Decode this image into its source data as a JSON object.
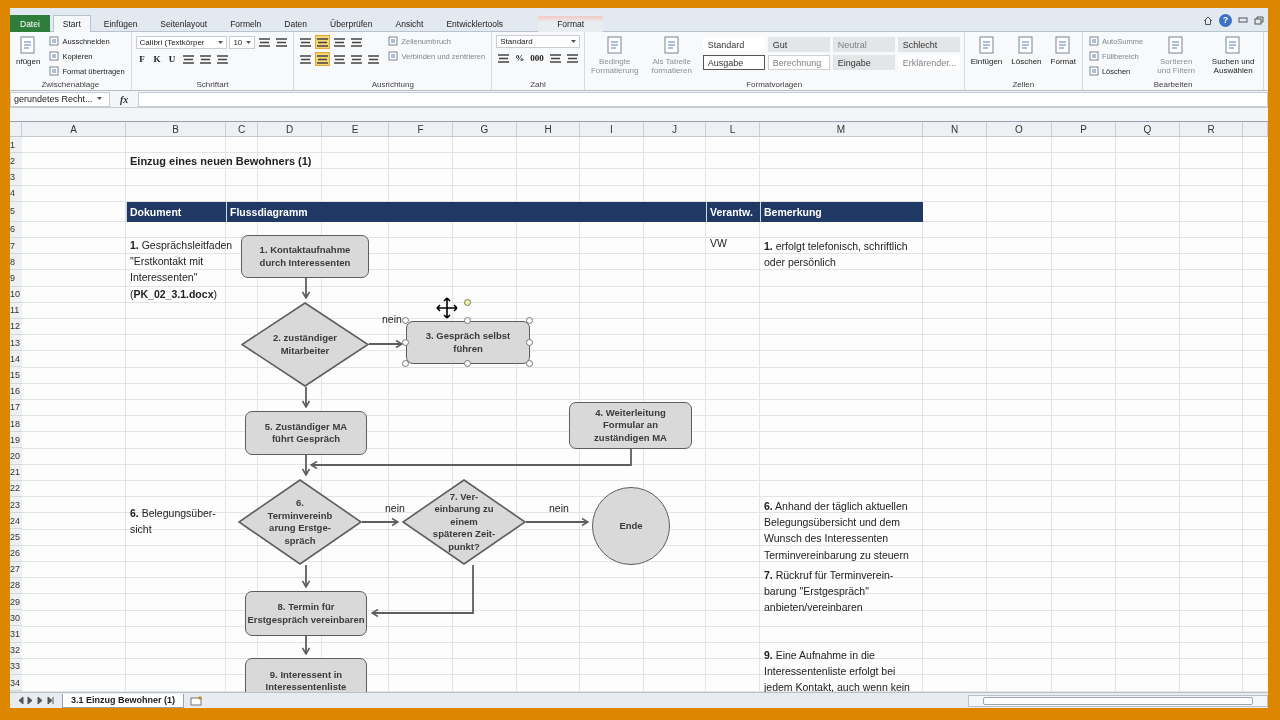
{
  "tabs": [
    {
      "label": "Datei",
      "kind": "file",
      "selected": false
    },
    {
      "label": "Start",
      "kind": "normal",
      "selected": true
    },
    {
      "label": "Einfügen",
      "kind": "normal",
      "selected": false
    },
    {
      "label": "Seitenlayout",
      "kind": "normal",
      "selected": false
    },
    {
      "label": "Formeln",
      "kind": "normal",
      "selected": false
    },
    {
      "label": "Daten",
      "kind": "normal",
      "selected": false
    },
    {
      "label": "Überprüfen",
      "kind": "normal",
      "selected": false
    },
    {
      "label": "Ansicht",
      "kind": "normal",
      "selected": false
    },
    {
      "label": "Entwicklertools",
      "kind": "normal",
      "selected": false
    },
    {
      "label": "Format",
      "kind": "contextual",
      "selected": false
    }
  ],
  "window_controls": {
    "help": "?"
  },
  "ribbon": {
    "groups": [
      {
        "label": "Zwischenablage",
        "columns": [
          [
            {
              "kind": "large",
              "label": "nfügen"
            }
          ],
          [
            {
              "kind": "small",
              "label": "Ausschneiden"
            },
            {
              "kind": "small",
              "label": "Kopieren"
            },
            {
              "kind": "small",
              "label": "Format übertragen"
            }
          ]
        ]
      },
      {
        "label": "Schriftart",
        "columns": [
          [
            {
              "kind": "row",
              "items": [
                {
                  "kind": "combo",
                  "value": "Calibri (Textkörper"
                },
                {
                  "kind": "combo",
                  "value": "10"
                },
                {
                  "kind": "icon"
                },
                {
                  "kind": "icon"
                }
              ]
            },
            {
              "kind": "row",
              "items": [
                {
                  "kind": "char",
                  "label": "F"
                },
                {
                  "kind": "char",
                  "label": "K"
                },
                {
                  "kind": "char",
                  "label": "U"
                },
                {
                  "kind": "icon"
                },
                {
                  "kind": "icon"
                },
                {
                  "kind": "icon"
                }
              ]
            }
          ]
        ]
      },
      {
        "label": "Ausrichtung",
        "columns": [
          [
            {
              "kind": "row",
              "items": [
                {
                  "kind": "icon",
                  "selected": false
                },
                {
                  "kind": "icon",
                  "selected": true
                },
                {
                  "kind": "icon",
                  "selected": false
                },
                {
                  "kind": "icon",
                  "selected": false
                }
              ]
            },
            {
              "kind": "row",
              "items": [
                {
                  "kind": "icon",
                  "selected": false
                },
                {
                  "kind": "icon",
                  "selected": true
                },
                {
                  "kind": "icon",
                  "selected": false
                },
                {
                  "kind": "icon",
                  "selected": false
                },
                {
                  "kind": "icon",
                  "selected": false
                }
              ]
            }
          ],
          [
            {
              "kind": "small",
              "label": "Zeilenumbruch",
              "disabled": true
            },
            {
              "kind": "small",
              "label": "Verbinden und zentrieren",
              "disabled": true
            }
          ]
        ]
      },
      {
        "label": "Zahl",
        "columns": [
          [
            {
              "kind": "combo",
              "value": "Standard"
            },
            {
              "kind": "row",
              "items": [
                {
                  "kind": "icon"
                },
                {
                  "kind": "char",
                  "label": "%"
                },
                {
                  "kind": "char",
                  "label": "000"
                },
                {
                  "kind": "icon"
                },
                {
                  "kind": "icon"
                }
              ]
            }
          ]
        ]
      },
      {
        "label": "Formatvorlagen",
        "columns": [
          [
            {
              "kind": "large",
              "label": "Bedingte Formatierung",
              "disabled": true
            }
          ],
          [
            {
              "kind": "large",
              "label": "Als Tabelle formatieren",
              "disabled": true
            }
          ],
          [
            {
              "kind": "styles",
              "items": [
                {
                  "label": "Standard",
                  "kind": "plain",
                  "disabled": false
                },
                {
                  "label": "Gut",
                  "kind": "filled",
                  "disabled": false
                },
                {
                  "label": "Neutral",
                  "kind": "filled",
                  "disabled": true
                },
                {
                  "label": "Schlecht",
                  "kind": "filled",
                  "disabled": false
                },
                {
                  "label": "Ausgabe",
                  "kind": "boxed",
                  "disabled": false
                },
                {
                  "label": "Berechnung",
                  "kind": "boxed",
                  "disabled": true
                },
                {
                  "label": "Eingabe",
                  "kind": "filled",
                  "disabled": false
                },
                {
                  "label": "Erklärender...",
                  "kind": "plain",
                  "disabled": true
                }
              ]
            }
          ]
        ]
      },
      {
        "label": "Zellen",
        "columns": [
          [
            {
              "kind": "large",
              "label": "Einfügen"
            }
          ],
          [
            {
              "kind": "large",
              "label": "Löschen"
            }
          ],
          [
            {
              "kind": "large",
              "label": "Format"
            }
          ]
        ]
      },
      {
        "label": "Bearbeiten",
        "columns": [
          [
            {
              "kind": "small",
              "label": "AutoSumme",
              "disabled": true
            },
            {
              "kind": "small",
              "label": "Füllbereich",
              "disabled": true
            },
            {
              "kind": "small",
              "label": "Löschen",
              "disabled": false
            }
          ],
          [
            {
              "kind": "large",
              "label": "Sortieren und Filtern",
              "disabled": true
            }
          ],
          [
            {
              "kind": "large",
              "label": "Suchen und Auswählen",
              "disabled": false
            }
          ]
        ]
      }
    ]
  },
  "formula_bar": {
    "name_box": "gerundetes Recht...",
    "fx": "fx"
  },
  "sheet": {
    "columns": [
      "A",
      "B",
      "C",
      "D",
      "E",
      "F",
      "G",
      "H",
      "I",
      "J",
      "L",
      "M",
      "N",
      "O",
      "P",
      "Q",
      "R"
    ],
    "row_headers": [
      "1",
      "2",
      "3",
      "4",
      "5",
      "6",
      "7",
      "8",
      "9",
      "10",
      "11",
      "12",
      "13",
      "14",
      "15",
      "16",
      "17",
      "18",
      "19",
      "20",
      "21",
      "22",
      "23",
      "24",
      "25",
      "26",
      "27",
      "28",
      "29",
      "30",
      "31",
      "32",
      "33",
      "34"
    ],
    "header": [
      "Dokument",
      "Flussdiagramm",
      "Verantw.",
      "Bemerkung"
    ],
    "texts": [
      {
        "kind": "title",
        "lines": [
          "Einzug eines neuen Bewohners (1)"
        ]
      },
      {
        "kind": "note",
        "lines": [
          "**1.** Gesprächsleitfaden",
          "\"Erstkontakt mit",
          "Interessenten\"",
          "(**PK_02_3.1.docx**)"
        ]
      },
      {
        "kind": "note",
        "lines": [
          "VW"
        ]
      },
      {
        "kind": "note",
        "lines": [
          "**1.** erfolgt telefonisch, schriftlich",
          "oder persönlich"
        ]
      },
      {
        "kind": "note",
        "lines": [
          "**6.** Belegungsüber-",
          "sicht"
        ]
      },
      {
        "kind": "note",
        "lines": [
          "**6.** Anhand der täglich aktuellen",
          "Belegungsübersicht und dem",
          "Wunsch des Interessenten",
          "Terminvereinbarung zu steuern"
        ]
      },
      {
        "kind": "note",
        "lines": [
          "**7.** Rückruf für Terminverein-",
          "barung \"Erstgespräch\"",
          "anbieten/vereinbaren"
        ]
      },
      {
        "kind": "note",
        "lines": [
          "**9.** Eine Aufnahme in die",
          "Interessentenliste erfolgt bei",
          "jedem Kontakt, auch wenn kein"
        ]
      }
    ]
  },
  "flowchart": {
    "nodes": [
      {
        "kind": "process",
        "lines": [
          "**1.** Kontaktaufnahme",
          "durch Interessenten"
        ],
        "selected": false
      },
      {
        "kind": "decision",
        "lines": [
          "**2.** zuständiger",
          "Mitarbeiter"
        ],
        "selected": false
      },
      {
        "kind": "process",
        "lines": [
          "**3.** Gespräch selbst",
          "führen"
        ],
        "selected": true
      },
      {
        "kind": "process",
        "lines": [
          "**5.** Zuständiger MA",
          "führt Gespräch"
        ],
        "selected": false
      },
      {
        "kind": "process",
        "lines": [
          "**4.** Weiterleitung",
          "Formular an",
          "zuständigen MA"
        ],
        "selected": false
      },
      {
        "kind": "decision",
        "lines": [
          "**6.**",
          "Terminvereinb",
          "arung Erstge-",
          "spräch"
        ],
        "selected": false
      },
      {
        "kind": "decision",
        "lines": [
          "**7.** Ver-",
          "einbarung zu",
          "einem",
          "späteren Zeit-",
          "punkt?"
        ],
        "selected": false
      },
      {
        "kind": "terminal",
        "lines": [
          "Ende"
        ],
        "selected": false
      },
      {
        "kind": "process",
        "lines": [
          "**8.** Termin für",
          "Erstgespräch vereinbaren"
        ],
        "selected": false
      },
      {
        "kind": "process",
        "lines": [
          "**9.** Interessent in",
          "Interessentenliste"
        ],
        "selected": false
      }
    ],
    "edge_labels": [
      "nein",
      "nein",
      "nein"
    ]
  },
  "sheet_tabs": [
    {
      "label": "3.1 Einzug Bewohner (1)",
      "selected": true
    }
  ]
}
